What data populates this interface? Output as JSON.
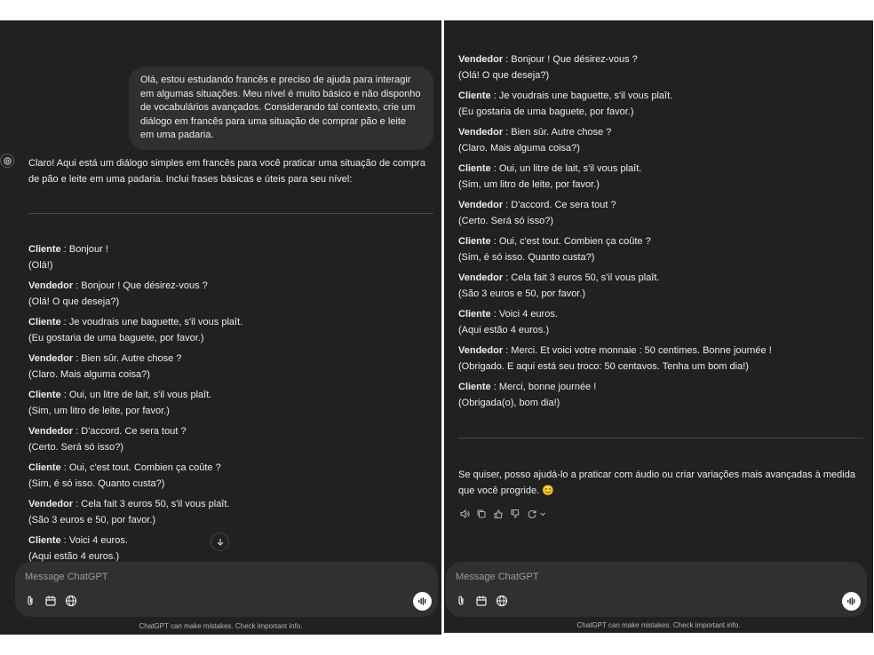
{
  "user_message": "Olá, estou estudando francês e preciso de ajuda para interagir em algumas situações. Meu nível é muito básico e não disponho de vocabulários avançados. Considerando tal contexto, crie um diálogo em francês para uma situação de comprar pão e leite em uma padaria.",
  "assistant_intro": "Claro! Aqui está um diálogo simples em francês para você praticar uma situação de compra de pão e leite em uma padaria. Inclui frases básicas e úteis para seu nível:",
  "dialog_left": [
    {
      "speaker": "Cliente",
      "french": " : Bonjour !",
      "pt": "(Olá!)"
    },
    {
      "speaker": "Vendedor",
      "french": " : Bonjour ! Que désirez-vous ?",
      "pt": "(Olá! O que deseja?)"
    },
    {
      "speaker": "Cliente",
      "french": " : Je voudrais une baguette, s'il vous plaît.",
      "pt": "(Eu gostaria de uma baguete, por favor.)"
    },
    {
      "speaker": "Vendedor",
      "french": " : Bien sûr. Autre chose ?",
      "pt": "(Claro. Mais alguma coisa?)"
    },
    {
      "speaker": "Cliente",
      "french": " : Oui, un litre de lait, s'il vous plaît.",
      "pt": "(Sim, um litro de leite, por favor.)"
    },
    {
      "speaker": "Vendedor",
      "french": " : D'accord. Ce sera tout ?",
      "pt": "(Certo. Será só isso?)"
    },
    {
      "speaker": "Cliente",
      "french": " : Oui, c'est tout. Combien ça coûte ?",
      "pt": "(Sim, é só isso. Quanto custa?)"
    },
    {
      "speaker": "Vendedor",
      "french": " : Cela fait 3 euros 50, s'il vous plaît.",
      "pt": "(São 3 euros e 50, por favor.)"
    },
    {
      "speaker": "Cliente",
      "french": " : Voici 4 euros.",
      "pt": "(Aqui estão 4 euros.)"
    }
  ],
  "dialog_right": [
    {
      "speaker": "Vendedor",
      "french": " : Bonjour ! Que désirez-vous ?",
      "pt": "(Olá! O que deseja?)"
    },
    {
      "speaker": "Cliente",
      "french": " : Je voudrais une baguette, s'il vous plaît.",
      "pt": "(Eu gostaria de uma baguete, por favor.)"
    },
    {
      "speaker": "Vendedor",
      "french": " : Bien sûr. Autre chose ?",
      "pt": "(Claro. Mais alguma coisa?)"
    },
    {
      "speaker": "Cliente",
      "french": " : Oui, un litre de lait, s'il vous plaît.",
      "pt": "(Sim, um litro de leite, por favor.)"
    },
    {
      "speaker": "Vendedor",
      "french": " : D'accord. Ce sera tout ?",
      "pt": "(Certo. Será só isso?)"
    },
    {
      "speaker": "Cliente",
      "french": " : Oui, c'est tout. Combien ça coûte ?",
      "pt": "(Sim, é só isso. Quanto custa?)"
    },
    {
      "speaker": "Vendedor",
      "french": " : Cela fait 3 euros 50, s'il vous plaît.",
      "pt": "(São 3 euros e 50, por favor.)"
    },
    {
      "speaker": "Cliente",
      "french": " : Voici 4 euros.",
      "pt": "(Aqui estão 4 euros.)"
    },
    {
      "speaker": "Vendedor",
      "french": " : Merci. Et voici votre monnaie : 50 centimes. Bonne journée !",
      "pt": "(Obrigado. E aqui está seu troco: 50 centavos. Tenha um bom dia!)"
    },
    {
      "speaker": "Cliente",
      "french": " : Merci, bonne journée !",
      "pt": "(Obrigada(o), bom dia!)"
    }
  ],
  "assistant_outro": "Se quiser, posso ajudá-lo a praticar com áudio ou criar variações mais avançadas à medida que você progride. 😊",
  "composer": {
    "placeholder": "Message ChatGPT"
  },
  "disclaimer": "ChatGPT can make mistakes. Check important info.",
  "icons": [
    "attach-icon",
    "tools-icon",
    "globe-icon",
    "voice-mode-icon",
    "arrow-down-icon",
    "openai-logo-icon",
    "speaker-icon",
    "copy-icon",
    "thumbs-up-icon",
    "thumbs-down-icon",
    "regenerate-icon",
    "chevron-down-icon"
  ]
}
